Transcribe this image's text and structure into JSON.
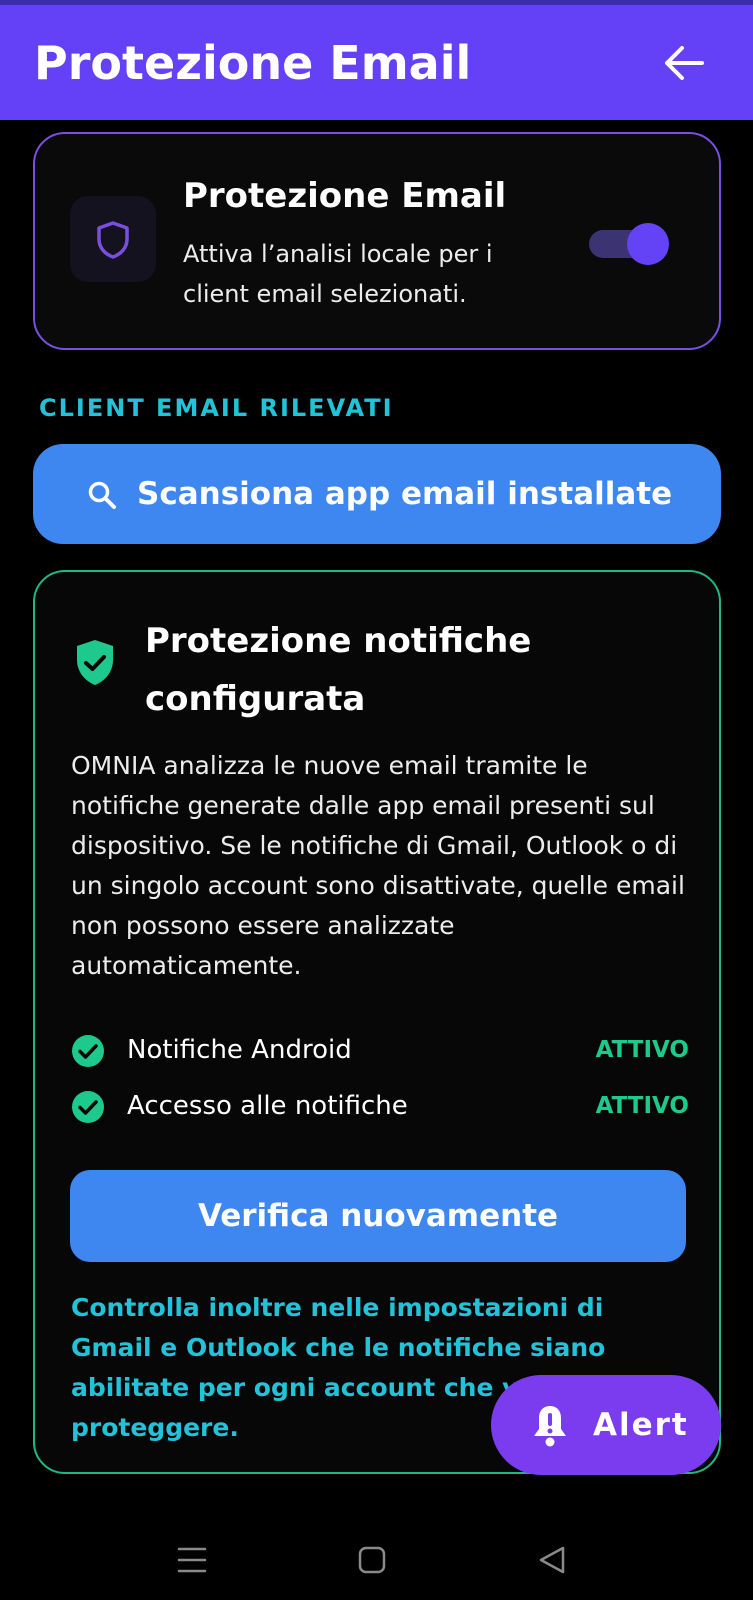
{
  "header": {
    "title": "Protezione Email",
    "back_icon": "arrow-left-icon",
    "background": "#6441f7"
  },
  "protection_card": {
    "icon": "shield-icon",
    "title": "Protezione Email",
    "description": "Attiva l’analisi locale per i client email selezionati.",
    "toggle_on": true
  },
  "section": {
    "label": "CLIENT EMAIL RILEVATI"
  },
  "scan_button": {
    "icon": "search-icon",
    "label": "Scansiona app email installate"
  },
  "notification_card": {
    "icon": "shield-check-icon",
    "title": "Protezione notifiche configurata",
    "body": "OMNIA analizza le nuove email tramite le notifiche generate dalle app email presenti sul dispositivo. Se le notifiche di Gmail, Outlook o di un singolo account sono disattivate, quelle email non possono essere analizzate automaticamente.",
    "statuses": [
      {
        "name": "Notifiche Android",
        "value": "ATTIVO"
      },
      {
        "name": "Accesso alle notifiche",
        "value": "ATTIVO"
      }
    ],
    "verify_label": "Verifica nuovamente",
    "note": "Controlla inoltre nelle impostazioni di Gmail e Outlook che le notifiche siano abilitate per ogni account che vuoi proteggere."
  },
  "alert_fab": {
    "icon": "bell-alert-icon",
    "label": "Alert"
  },
  "navigation": {
    "recents_icon": "menu-lines-icon",
    "home_icon": "square-home-icon",
    "back_icon": "triangle-back-icon"
  },
  "colors": {
    "accent_purple": "#6441f7",
    "accent_blue": "#3e86f0",
    "success_green": "#1ec98d",
    "cyan": "#22c3d8"
  }
}
